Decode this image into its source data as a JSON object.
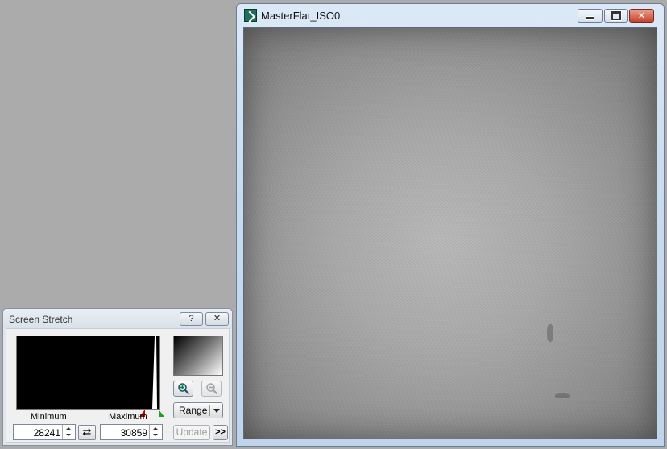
{
  "image_window": {
    "title": "MasterFlat_ISO0",
    "controls": {
      "minimize": "▭",
      "maximize": "□",
      "close": "✕"
    }
  },
  "screen_stretch": {
    "title": "Screen Stretch",
    "help_label": "?",
    "close_label": "✕",
    "minimum_label": "Minimum",
    "maximum_label": "Maximum",
    "minimum_value": "28241",
    "maximum_value": "30859",
    "swap_glyph": "⇄",
    "range_label": "Range",
    "update_label": "Update",
    "more_label": ">>",
    "icons": {
      "zoom_in": "zoom-in-icon",
      "zoom_out": "zoom-out-icon"
    }
  }
}
